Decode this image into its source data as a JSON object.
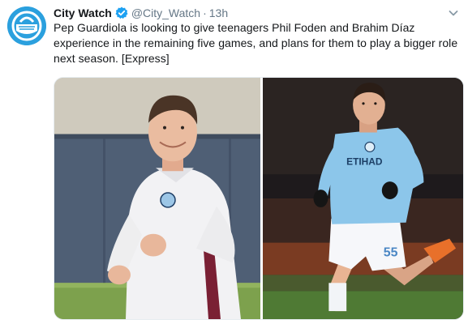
{
  "tweet": {
    "display_name": "City Watch",
    "handle": "@City_Watch",
    "separator": "·",
    "timestamp": "13h",
    "text": "Pep Guardiola is looking to give teenagers Phil Foden and Brahim Díaz experience in the remaining five games, and plans for them to play a bigger role next season. [Express]",
    "verified": true,
    "avatar_icon": "city-watch-logo",
    "media": [
      {
        "description_icon": "photo-player-white-training-top"
      },
      {
        "description_icon": "photo-player-sky-blue-kit-number-55"
      }
    ]
  },
  "colors": {
    "accent": "#1da1f2",
    "avatar_bg": "#2ba0de",
    "secondary_text": "#657786",
    "primary_text": "#14171a"
  }
}
